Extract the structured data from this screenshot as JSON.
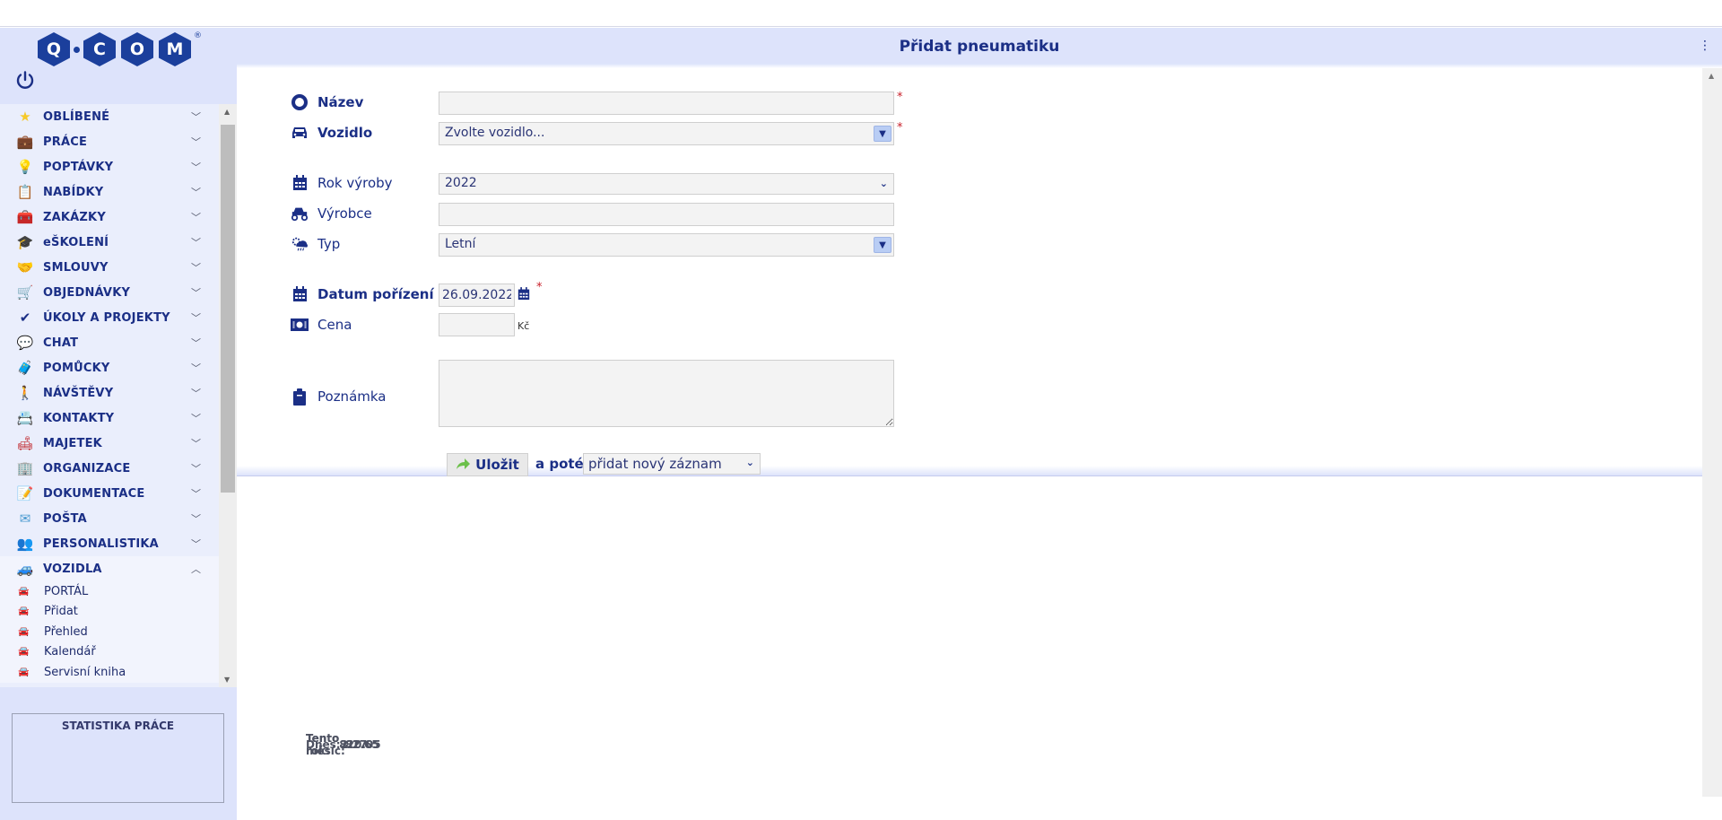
{
  "app": {
    "logo_letters": [
      "Q",
      "C",
      "O",
      "M"
    ],
    "logo_registered": "®"
  },
  "header": {
    "title": "Přidat pneumatiku",
    "menu_icon": "⋮"
  },
  "sidebar": {
    "items": [
      {
        "label": "OBLÍBENÉ",
        "icon": "star-icon",
        "glyph": "★",
        "color": "#f6c928"
      },
      {
        "label": "PRÁCE",
        "icon": "briefcase-icon",
        "glyph": "💼",
        "color": "#b0562a"
      },
      {
        "label": "POPTÁVKY",
        "icon": "lightbulb-icon",
        "glyph": "💡",
        "color": "#4e7fa8"
      },
      {
        "label": "NABÍDKY",
        "icon": "clipboard-icon",
        "glyph": "📋",
        "color": "#6d7f95"
      },
      {
        "label": "ZAKÁZKY",
        "icon": "case-icon",
        "glyph": "🧰",
        "color": "#4b8ab3"
      },
      {
        "label": "eŠKOLENÍ",
        "icon": "graduation-cap-icon",
        "glyph": "🎓",
        "color": "#333333"
      },
      {
        "label": "SMLOUVY",
        "icon": "handshake-icon",
        "glyph": "🤝",
        "color": "#5c8fb3"
      },
      {
        "label": "OBJEDNÁVKY",
        "icon": "cart-icon",
        "glyph": "🛒",
        "color": "#d8a42a"
      },
      {
        "label": "ÚKOLY A PROJEKTY",
        "icon": "task-clipboard-icon",
        "glyph": "✔",
        "color": "#1b2f86"
      },
      {
        "label": "CHAT",
        "icon": "chat-bubble-icon",
        "glyph": "💬",
        "color": "#4fb3e0"
      },
      {
        "label": "POMŮCKY",
        "icon": "toolbox-icon",
        "glyph": "🧳",
        "color": "#c99147"
      },
      {
        "label": "NÁVŠTĚVY",
        "icon": "walking-person-icon",
        "glyph": "🚶",
        "color": "#1b2f86"
      },
      {
        "label": "KONTAKTY",
        "icon": "contact-card-icon",
        "glyph": "📇",
        "color": "#5f9e5f"
      },
      {
        "label": "MAJETEK",
        "icon": "armchair-icon",
        "glyph": "🛋",
        "color": "#c0262b"
      },
      {
        "label": "ORGANIZACE",
        "icon": "buildings-icon",
        "glyph": "🏢",
        "color": "#3f7bd0"
      },
      {
        "label": "DOKUMENTACE",
        "icon": "document-icon",
        "glyph": "📝",
        "color": "#e6c25a"
      },
      {
        "label": "POŠTA",
        "icon": "envelope-icon",
        "glyph": "✉",
        "color": "#4a9ad0"
      },
      {
        "label": "PERSONALISTIKA",
        "icon": "people-icon",
        "glyph": "👥",
        "color": "#8a6a4c"
      },
      {
        "label": "VOZIDLA",
        "icon": "car-icon",
        "glyph": "🚙",
        "color": "#777777",
        "open": true
      }
    ],
    "vozidla_sub": [
      {
        "label": "PORTÁL"
      },
      {
        "label": "Přidat"
      },
      {
        "label": "Přehled"
      },
      {
        "label": "Kalendář"
      },
      {
        "label": "Servisní kniha"
      }
    ],
    "stats": {
      "title": "STATISTIKA PRÁCE",
      "rows": [
        {
          "label": "Dnes:",
          "value": "2.17"
        },
        {
          "label": "Tento měsíc:",
          "value": "82.65"
        },
        {
          "label": "Tento rok:",
          "value": "820.05"
        }
      ]
    }
  },
  "form": {
    "nazev": {
      "label": "Název",
      "value": "",
      "required": "*"
    },
    "vozidlo": {
      "label": "Vozidlo",
      "value": "Zvolte vozidlo...",
      "required": "*"
    },
    "rok_vyroby": {
      "label": "Rok výroby",
      "value": "2022"
    },
    "vyrobce": {
      "label": "Výrobce",
      "value": ""
    },
    "typ": {
      "label": "Typ",
      "value": "Letní"
    },
    "datum_porizeni": {
      "label": "Datum pořízení",
      "value": "26.09.2022",
      "required": "*"
    },
    "cena": {
      "label": "Cena",
      "value": "",
      "unit": "Kč"
    },
    "poznamka": {
      "label": "Poznámka",
      "value": ""
    },
    "save_label": "Uložit",
    "after_label": "a poté",
    "after_value": "přidat nový záznam"
  },
  "colors": {
    "brand": "#1b2f86",
    "sidebar_bg": "#dde3fb",
    "required": "#c8202a"
  }
}
